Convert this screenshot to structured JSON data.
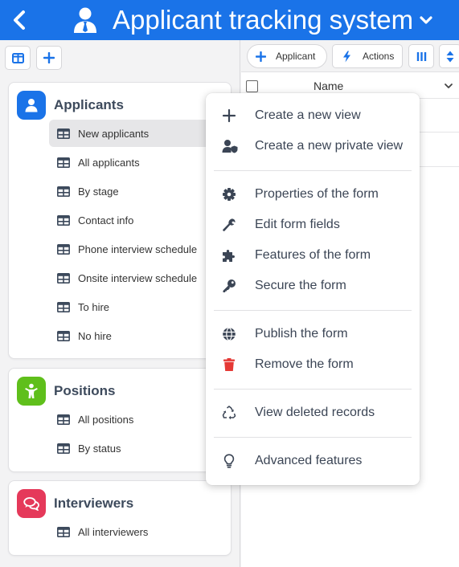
{
  "header": {
    "title": "Applicant tracking system",
    "color": "#1a73e8"
  },
  "left_toolbar": {
    "buttons": [
      "layout-icon",
      "plus-icon"
    ]
  },
  "sections": [
    {
      "title": "Applicants",
      "icon": "user-icon",
      "color": "#1a73e8",
      "views": [
        "New applicants",
        "All applicants",
        "By stage",
        "Contact info",
        "Phone interview schedule",
        "Onsite interview schedule",
        "To hire",
        "No hire"
      ],
      "selected_view": "New applicants"
    },
    {
      "title": "Positions",
      "icon": "person-up-icon",
      "color": "#5fbf1b",
      "views": [
        "All positions",
        "By status"
      ]
    },
    {
      "title": "Interviewers",
      "icon": "chat-bubbles-icon",
      "color": "#e5395a",
      "views": [
        "All interviewers"
      ]
    }
  ],
  "right_toolbar": {
    "add_label": "Applicant",
    "actions_label": "Actions"
  },
  "table": {
    "columns": [
      "Name"
    ]
  },
  "menu": {
    "groups": [
      [
        {
          "label": "Create a new view",
          "icon": "plus-icon"
        },
        {
          "label": "Create a new private view",
          "icon": "user-shield-icon"
        }
      ],
      [
        {
          "label": "Properties of the form",
          "icon": "gear-icon"
        },
        {
          "label": "Edit form fields",
          "icon": "wrench-icon"
        },
        {
          "label": "Features of the form",
          "icon": "puzzle-icon"
        },
        {
          "label": "Secure the form",
          "icon": "key-icon"
        }
      ],
      [
        {
          "label": "Publish the form",
          "icon": "globe-icon"
        },
        {
          "label": "Remove the form",
          "icon": "trash-icon"
        }
      ],
      [
        {
          "label": "View deleted records",
          "icon": "recycle-icon"
        }
      ],
      [
        {
          "label": "Advanced features",
          "icon": "lightbulb-icon"
        }
      ]
    ],
    "danger_color": "#e53935"
  }
}
